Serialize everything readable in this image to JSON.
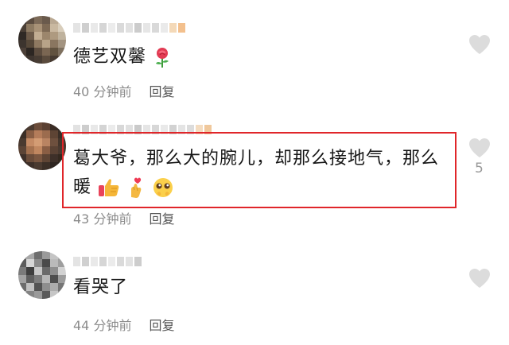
{
  "comments": [
    {
      "text": "德艺双馨",
      "time": "40 分钟前",
      "reply_label": "回复",
      "like_count": "",
      "emojis": [
        "rose"
      ]
    },
    {
      "text_line1": "葛大爷，那么大的腕儿，却那么接地气，那么",
      "text_line2": "暖",
      "time": "43 分钟前",
      "reply_label": "回复",
      "like_count": "5",
      "emojis": [
        "thumbs-up",
        "finger-heart",
        "pleading-face"
      ],
      "highlighted": true
    },
    {
      "text": "看哭了",
      "time": "44 分钟前",
      "reply_label": "回复",
      "like_count": ""
    }
  ],
  "colors": {
    "highlight_border": "#e0262a",
    "heart_fill": "#dcdcdc",
    "meta_text": "#8b8b8b"
  }
}
